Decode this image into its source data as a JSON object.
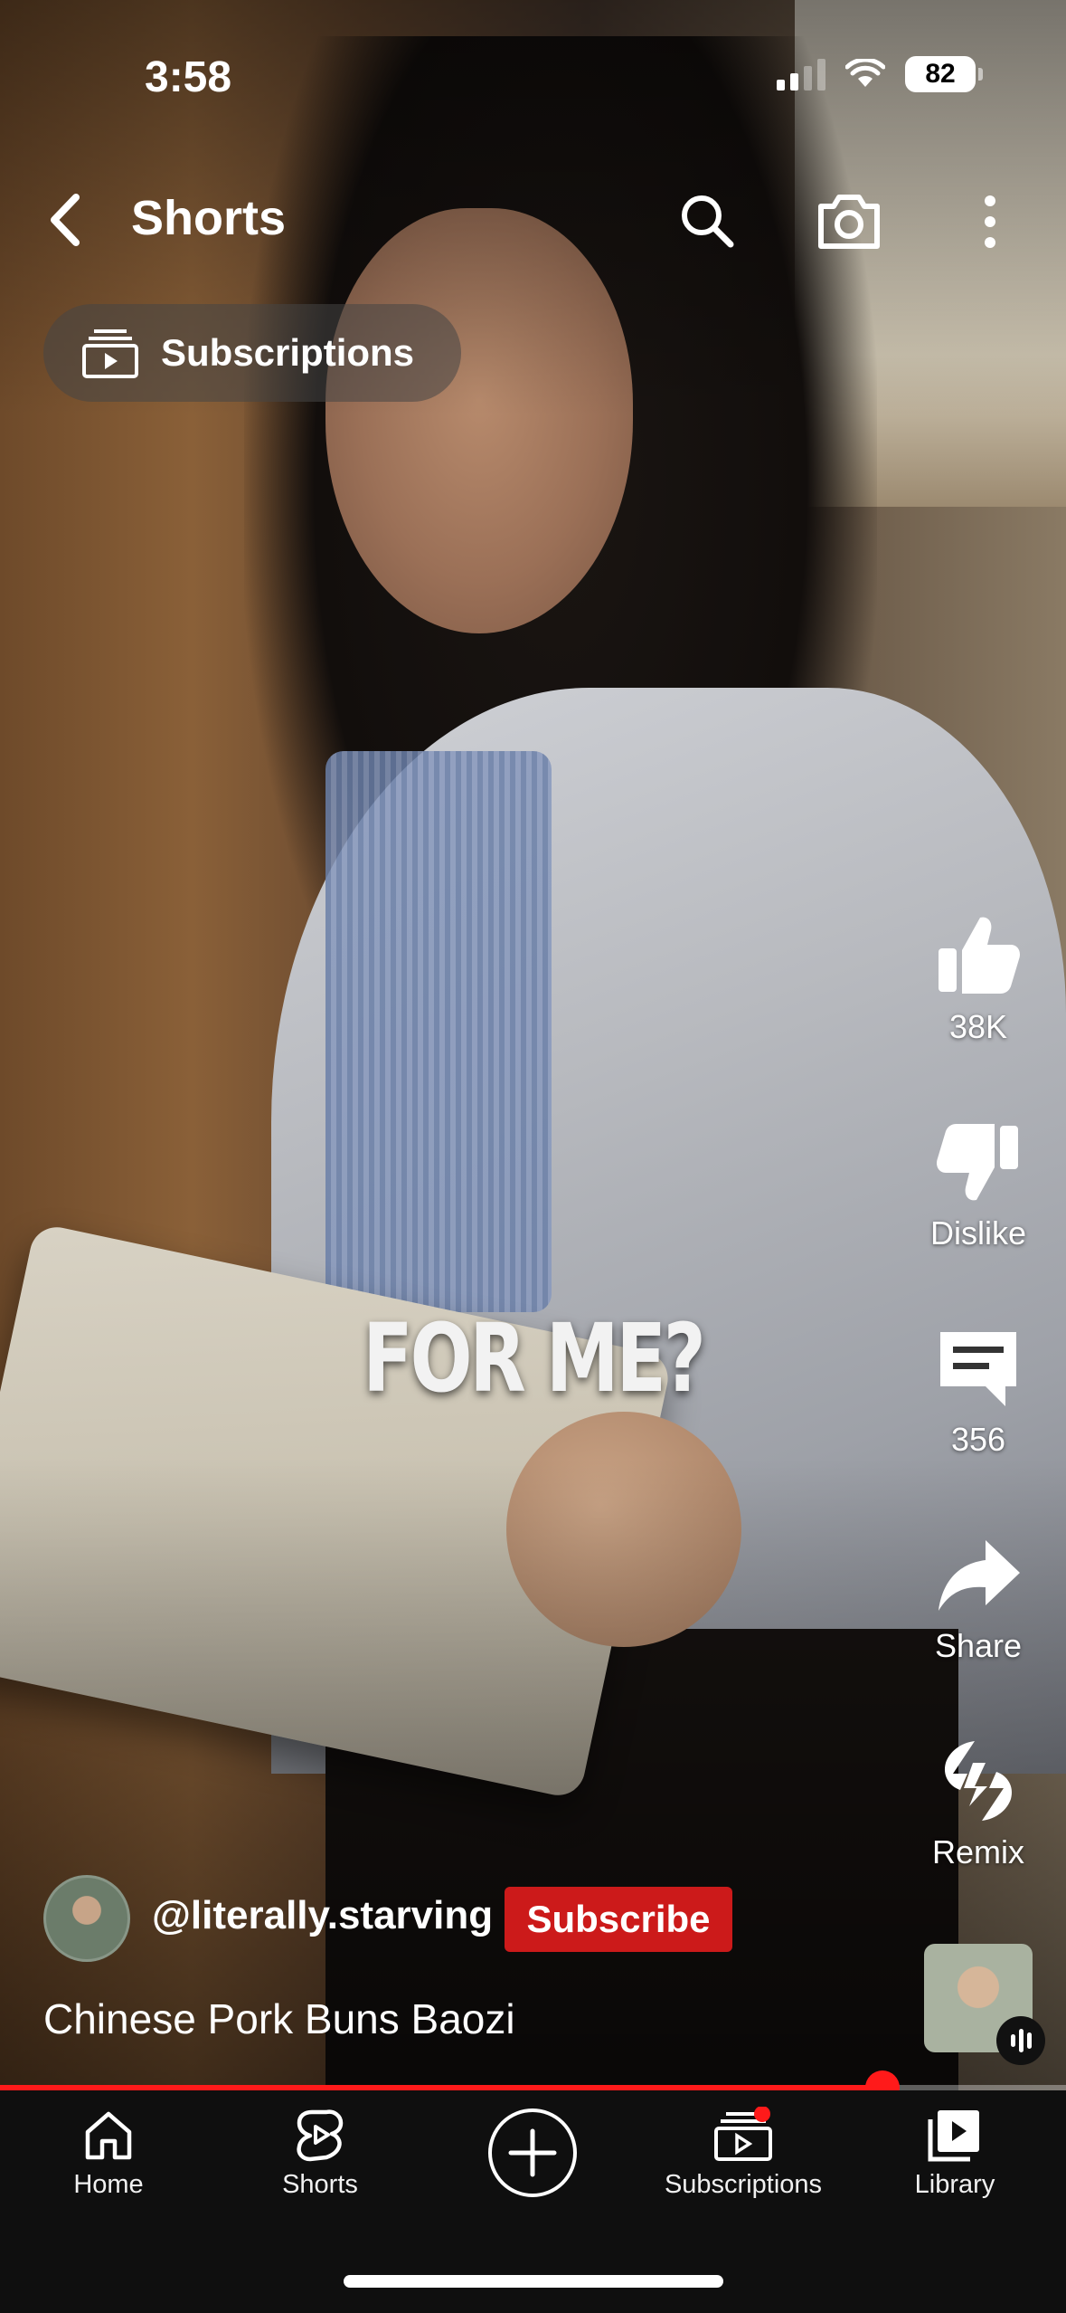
{
  "status_bar": {
    "time": "3:58",
    "battery": "82"
  },
  "header": {
    "title": "Shorts"
  },
  "subscriptions_pill": {
    "label": "Subscriptions"
  },
  "video": {
    "overlay_caption": "FOR ME?"
  },
  "actions": {
    "like_count": "38K",
    "dislike_label": "Dislike",
    "comment_count": "356",
    "share_label": "Share",
    "remix_label": "Remix"
  },
  "channel": {
    "handle": "@literally.starving",
    "subscribe_label": "Subscribe"
  },
  "video_title": "Chinese Pork Buns Baozi",
  "progress": {
    "played_fraction": 0.828
  },
  "bottom_nav": {
    "home": "Home",
    "shorts": "Shorts",
    "subscriptions": "Subscriptions",
    "library": "Library"
  },
  "colors": {
    "accent_red": "#cc1a1a",
    "progress_red": "#ff1a1a",
    "nav_bg": "#0f0f0f"
  },
  "icons": [
    "back-icon",
    "search-icon",
    "camera-icon",
    "more-icon",
    "subscriptions-icon",
    "like-icon",
    "dislike-icon",
    "comment-icon",
    "share-icon",
    "remix-icon",
    "home-icon",
    "shorts-icon",
    "create-icon",
    "library-icon"
  ]
}
